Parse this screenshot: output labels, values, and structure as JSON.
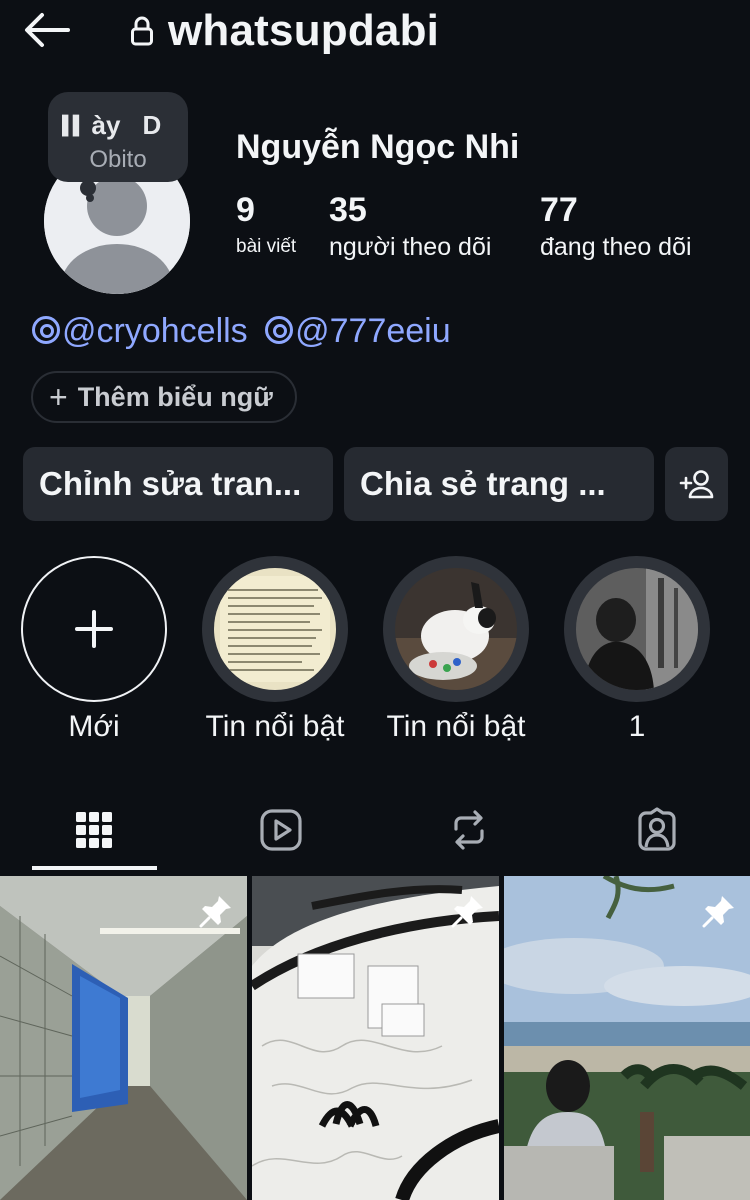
{
  "header": {
    "username": "whatsupdabi",
    "back_icon": "arrow-left-icon",
    "lock_icon": "lock-icon"
  },
  "note": {
    "track": "ày",
    "track_tail": "D",
    "artist": "Obito"
  },
  "profile": {
    "full_name": "Nguyễn Ngọc Nhi",
    "stats": {
      "posts": {
        "value": "9",
        "label": "bài viết"
      },
      "followers": {
        "value": "35",
        "label": "người theo dõi"
      },
      "following": {
        "value": "77",
        "label": "đang theo dõi"
      }
    },
    "links": [
      "@cryohcells",
      "@777eeiu"
    ],
    "add_banner": "Thêm biểu ngữ"
  },
  "actions": {
    "edit": "Chỉnh sửa tran...",
    "share": "Chia sẻ trang ...",
    "discover_icon": "add-person-icon"
  },
  "highlights": [
    {
      "label": "Mới",
      "type": "new"
    },
    {
      "label": "Tin nổi bật",
      "type": "notes-photo"
    },
    {
      "label": "Tin nổi bật",
      "type": "rabbit-photo"
    },
    {
      "label": "1",
      "type": "bw-person-photo"
    }
  ],
  "tabs": [
    {
      "icon": "grid-icon",
      "active": true
    },
    {
      "icon": "reels-icon",
      "active": false
    },
    {
      "icon": "reposts-icon",
      "active": false
    },
    {
      "icon": "tagged-icon",
      "active": false
    }
  ],
  "posts": [
    {
      "content": "subway-tunnel-photo",
      "pinned": true
    },
    {
      "content": "white-jersey-photo",
      "pinned": true
    },
    {
      "content": "beach-photo",
      "pinned": true
    }
  ],
  "colors": {
    "background": "#0c0f14",
    "button": "#262a31",
    "link": "#8fa8ff",
    "text": "#f3f5f7"
  }
}
